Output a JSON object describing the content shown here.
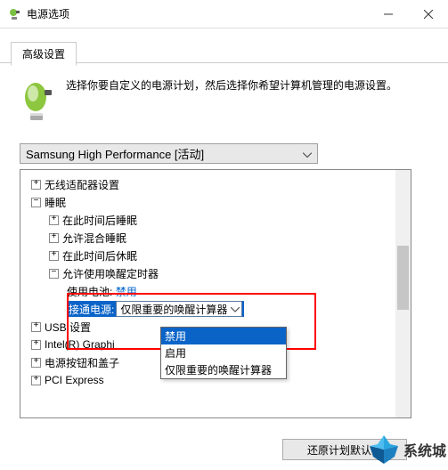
{
  "window": {
    "title": "电源选项",
    "tab": "高级设置",
    "intro": "选择你要自定义的电源计划，然后选择你希望计算机管理的电源设置。",
    "plan": "Samsung High Performance [活动]",
    "restore": "还原计划默认值"
  },
  "tree": {
    "wireless": "无线适配器设置",
    "sleep": "睡眠",
    "sleep_after": "在此时间后睡眠",
    "hybrid": "允许混合睡眠",
    "hibernate_after": "在此时间后休眠",
    "wake_timers": "允许使用唤醒定时器",
    "battery_label": "使用电池:",
    "battery_value": "禁用",
    "ac_label": "接通电源:",
    "ac_value": "仅限重要的唤醒计算器",
    "usb": "USB 设置",
    "intel": "Intel(R) Graphi",
    "power_buttons": "电源按钮和盖子",
    "pci": "PCI Express"
  },
  "dropdown": {
    "opt1": "禁用",
    "opt2": "启用",
    "opt3": "仅限重要的唤醒计算器"
  },
  "watermark": "系统城"
}
